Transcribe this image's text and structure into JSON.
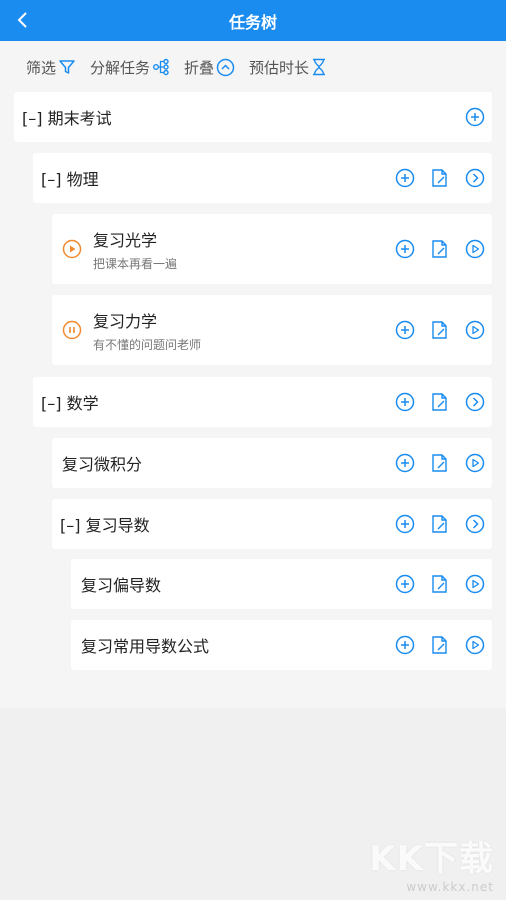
{
  "header": {
    "title": "任务树"
  },
  "toolbar": {
    "filter": "筛选",
    "decompose": "分解任务",
    "collapse": "折叠",
    "estimate": "预估时长"
  },
  "colors": {
    "primary": "#1a8cf0",
    "accent": "#f08a30"
  },
  "tree": [
    {
      "prefix": "[–]",
      "title": "期末考试"
    },
    {
      "prefix": "[–]",
      "title": "物理"
    },
    {
      "title": "复习光学",
      "sub": "把课本再看一遍",
      "status": "play-circle-icon"
    },
    {
      "title": "复习力学",
      "sub": "有不懂的问题问老师",
      "status": "pause-circle-icon"
    },
    {
      "prefix": "[–]",
      "title": "数学"
    },
    {
      "title": "复习微积分"
    },
    {
      "prefix": "[–]",
      "title": "复习导数"
    },
    {
      "title": "复习偏导数"
    },
    {
      "title": "复习常用导数公式"
    }
  ],
  "watermark": {
    "brand": "KK下载",
    "url": "www.kkx.net"
  }
}
